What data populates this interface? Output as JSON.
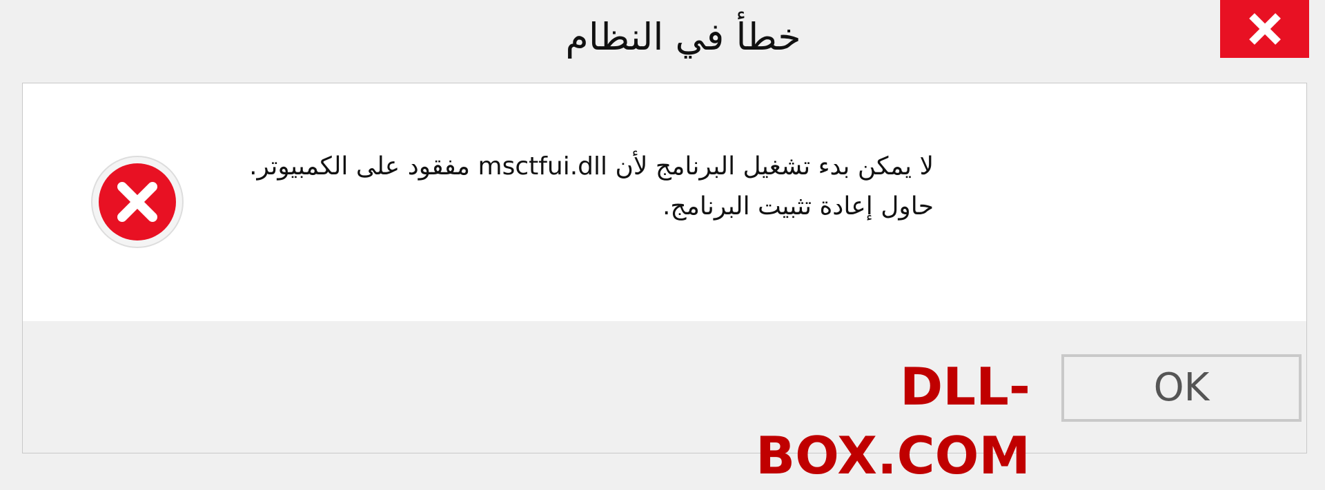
{
  "window": {
    "title": "خطأ في النظام",
    "close_icon": "close-icon",
    "close_color": "#e81123"
  },
  "dialog": {
    "icon": "error-icon",
    "icon_color": "#e81123",
    "message_part1": "لا يمكن بدء تشغيل البرنامج لأن ",
    "dll_name": "msctfui.dll",
    "message_part2": " مفقود على الكمبيوتر. حاول إعادة تثبيت البرنامج."
  },
  "footer": {
    "brand": "DLL-BOX.COM",
    "brand_color": "#c00000",
    "ok_label": "OK"
  }
}
